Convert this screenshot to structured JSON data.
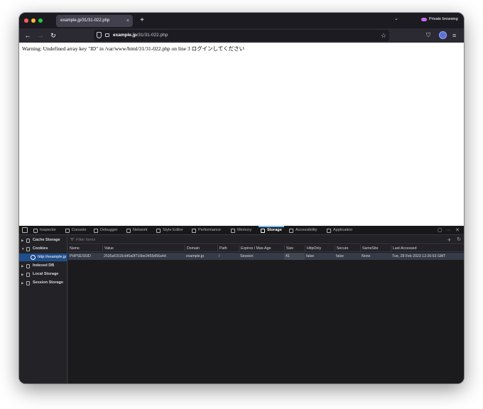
{
  "tab": {
    "title": "example.jp/31/31-022.php",
    "close": "×",
    "new_tab": "+"
  },
  "window": {
    "tab_list": "⌄",
    "private_label": "Private browsing"
  },
  "nav": {
    "back": "←",
    "forward": "→",
    "reload": "↻",
    "url_host": "example.jp",
    "url_path": "/31/31-022.php",
    "bookmark": "☆",
    "pocket": "⛉",
    "menu": "≡"
  },
  "page": {
    "warning_text": "Warning: Undefined array key \"ID\" in /var/www/html/31/31-022.php on line 3 ログインしてください"
  },
  "devtools": {
    "tabs": [
      {
        "label": "Inspector",
        "active": false
      },
      {
        "label": "Console",
        "active": false
      },
      {
        "label": "Debugger",
        "active": false
      },
      {
        "label": "Network",
        "active": false
      },
      {
        "label": "Style Editor",
        "active": false
      },
      {
        "label": "Performance",
        "active": false
      },
      {
        "label": "Memory",
        "active": false
      },
      {
        "label": "Storage",
        "active": true
      },
      {
        "label": "Accessibility",
        "active": false
      },
      {
        "label": "Application",
        "active": false
      }
    ],
    "right_icons": {
      "dock": "▢",
      "more": "···",
      "close": "✕"
    },
    "sidebar": {
      "items": [
        {
          "label": "Cache Storage",
          "expanded": false
        },
        {
          "label": "Cookies",
          "expanded": true
        },
        {
          "label": "http://example.jp",
          "selected": true
        },
        {
          "label": "Indexed DB",
          "expanded": false
        },
        {
          "label": "Local Storage",
          "expanded": false
        },
        {
          "label": "Session Storage",
          "expanded": false
        }
      ]
    },
    "filter": {
      "placeholder": "Filter Items",
      "add": "+",
      "refresh": "↻"
    },
    "table": {
      "columns": [
        "Name",
        "Value",
        "Domain",
        "Path",
        "Expires / Max-Age",
        "Size",
        "HttpOnly",
        "Secure",
        "SameSite",
        "Last Accessed"
      ],
      "rows": [
        {
          "name": "PHPSESSID",
          "value": "2535af1515cbf0a0f716be3455d56a4d",
          "domain": "example.jp",
          "path": "/",
          "expires": "Session",
          "size": "41",
          "httponly": "false",
          "secure": "false",
          "samesite": "None",
          "last_accessed": "Tue, 28 Feb 2023 12:26:53 GMT"
        }
      ]
    }
  },
  "colors": {
    "chrome_dark": "#1c1b22",
    "toolbar": "#2b2a33",
    "devtools_bg": "#1b1b1d",
    "selection": "#204e8a",
    "active_tab_indicator": "#75bfff"
  }
}
